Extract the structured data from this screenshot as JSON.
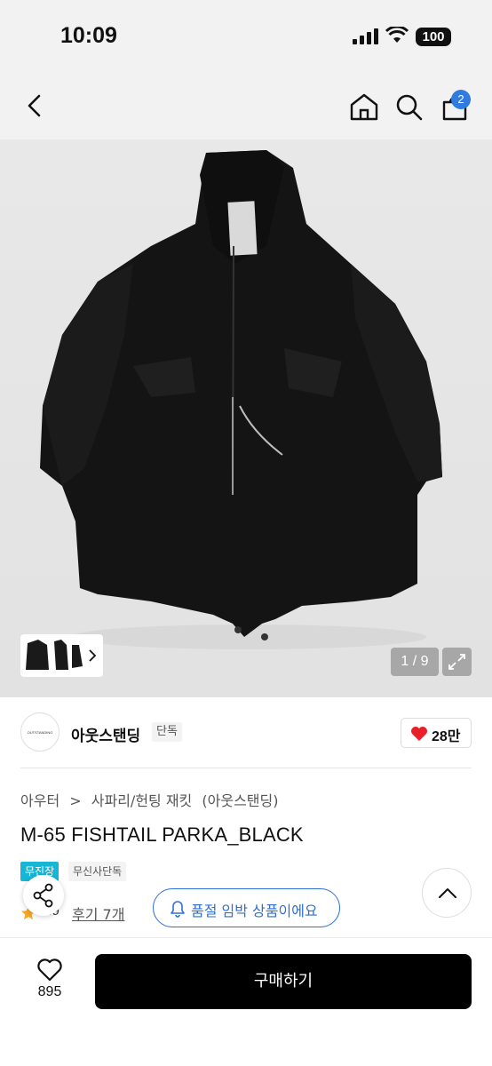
{
  "status": {
    "time": "10:09",
    "battery": "100"
  },
  "header": {
    "cart_count": "2"
  },
  "gallery": {
    "page": "1 / 9"
  },
  "brand": {
    "logo_text": "OUTSTANDING",
    "name": "아웃스탠딩",
    "tag": "단독",
    "likes": "28만"
  },
  "breadcrumb": [
    "아우터",
    ">",
    "사파리/헌팅 재킷",
    "(아웃스탠딩)"
  ],
  "product": {
    "title": "M-65 FISHTAIL PARKA_BLACK",
    "badge_free": "무진장",
    "badge_exclusive": "무신사단독",
    "rating": "4.9",
    "reviews": "후기 7개"
  },
  "stock_notice": "품절 임박 상품이에요",
  "bottom_bar": {
    "wish_count": "895",
    "buy_label": "구매하기"
  },
  "colors": {
    "accent_blue": "#2f6fd6",
    "badge_cyan": "#17b6d6",
    "like_red": "#e8202a"
  }
}
